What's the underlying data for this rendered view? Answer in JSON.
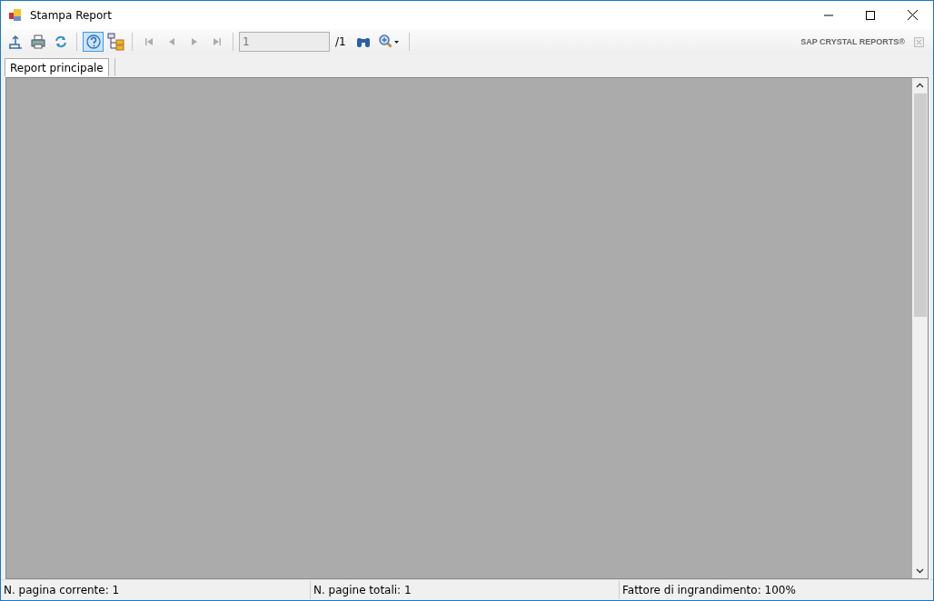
{
  "window": {
    "title": "Stampa Report"
  },
  "toolbar": {
    "groups": [
      [
        {
          "kind": "export",
          "selected": false,
          "disabled": false
        },
        {
          "kind": "print",
          "selected": false,
          "disabled": false
        },
        {
          "kind": "refresh",
          "selected": false,
          "disabled": false
        }
      ],
      [
        {
          "kind": "help",
          "selected": true,
          "disabled": false
        },
        {
          "kind": "tree",
          "selected": false,
          "disabled": false
        }
      ],
      [
        {
          "kind": "first",
          "selected": false,
          "disabled": true
        },
        {
          "kind": "prev",
          "selected": false,
          "disabled": true
        },
        {
          "kind": "next",
          "selected": false,
          "disabled": true
        },
        {
          "kind": "last",
          "selected": false,
          "disabled": true
        }
      ]
    ],
    "page_field": {
      "value": "1",
      "disabled": true
    },
    "page_total": "/1",
    "brand": "SAP CRYSTAL REPORTS®"
  },
  "tabs": [
    {
      "label": "Report principale",
      "selected": true
    }
  ],
  "status_bar": [
    "N. pagina corrente: 1",
    "N. pagine totali: 1",
    "Fattore di ingrandimento: 100%"
  ]
}
